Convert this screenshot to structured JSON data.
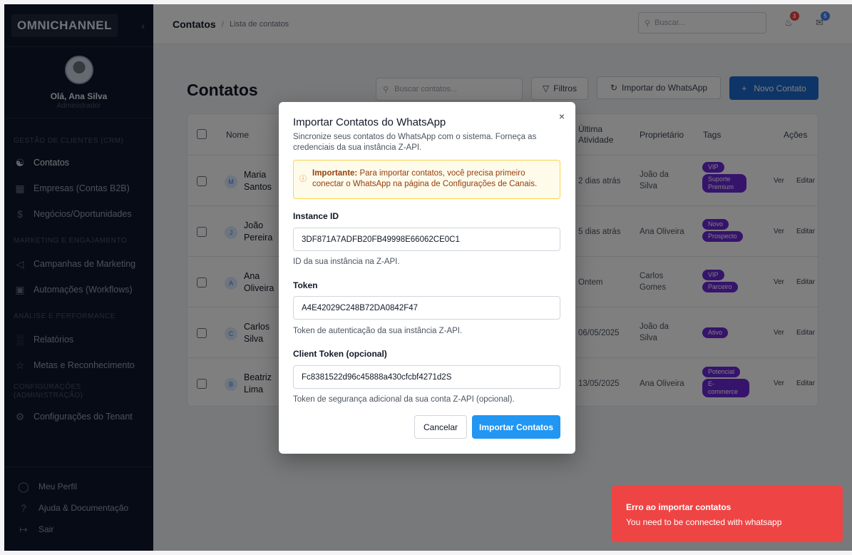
{
  "sidebar": {
    "logo": "OMNICHANNEL",
    "collapse": "‹",
    "greeting": "Olá, Ana Silva",
    "role": "Administrador",
    "sections": [
      {
        "title": "GESTÃO DE CLIENTES (CRM)"
      },
      {
        "title": "MARKETING E ENGAJAMENTO"
      },
      {
        "title": "ANÁLISE E PERFORMANCE"
      },
      {
        "title": "CONFIGURAÇÕES (ADMINISTRAÇÃO)"
      }
    ],
    "items": [
      {
        "label": "Contatos",
        "icon": "users-icon"
      },
      {
        "label": "Empresas (Contas B2B)",
        "icon": "building-icon"
      },
      {
        "label": "Negócios/Oportunidades",
        "icon": "dollar-icon"
      },
      {
        "label": "Campanhas de Marketing",
        "icon": "megaphone-icon"
      },
      {
        "label": "Automações (Workflows)",
        "icon": "bot-icon"
      },
      {
        "label": "Relatórios",
        "icon": "bar-chart-icon"
      },
      {
        "label": "Metas e Reconhecimento",
        "icon": "trophy-icon"
      },
      {
        "label": "Configurações do Tenant",
        "icon": "gear-icon"
      }
    ],
    "bottom": [
      {
        "label": "Meu Perfil",
        "icon": "user-icon"
      },
      {
        "label": "Ajuda & Documentação",
        "icon": "help-icon"
      },
      {
        "label": "Sair",
        "icon": "logout-icon"
      }
    ]
  },
  "topbar": {
    "breadcrumb_main": "Contatos",
    "breadcrumb_sep": "/",
    "breadcrumb_sub": "Lista de contatos",
    "search_placeholder": "Buscar...",
    "notifications_count": "3",
    "messages_count": "5"
  },
  "page": {
    "title": "Contatos",
    "search_placeholder": "Buscar contatos...",
    "filters_label": "Filtros",
    "import_label": "Importar do WhatsApp",
    "new_label": "Novo Contato",
    "new_icon": "+"
  },
  "table": {
    "headers": {
      "name": "Nome",
      "last_activity": "Última Atividade",
      "owner": "Proprietário",
      "tags": "Tags",
      "actions": "Ações"
    },
    "view_label": "Ver",
    "edit_label": "Editar",
    "rows": [
      {
        "initial": "M",
        "name": "Maria Santos",
        "activity": "2 dias atrás",
        "owner": "João da Silva",
        "tags": [
          "VIP",
          "Suporte Premium"
        ]
      },
      {
        "initial": "J",
        "name": "João Pereira",
        "activity": "5 dias atrás",
        "owner": "Ana Oliveira",
        "tags": [
          "Novo",
          "Prospecto"
        ]
      },
      {
        "initial": "A",
        "name": "Ana Oliveira",
        "activity": "Ontem",
        "owner": "Carlos Gomes",
        "tags": [
          "VIP",
          "Parceiro"
        ]
      },
      {
        "initial": "C",
        "name": "Carlos Silva",
        "activity": "06/05/2025",
        "owner": "João da Silva",
        "tags": [
          "Ativo"
        ]
      },
      {
        "initial": "B",
        "name": "Beatriz Lima",
        "activity": "13/05/2025",
        "owner": "Ana Oliveira",
        "tags": [
          "Potencial",
          "E-commerce"
        ]
      }
    ]
  },
  "modal": {
    "close": "×",
    "title": "Importar Contatos do WhatsApp",
    "description": "Sincronize seus contatos do WhatsApp com o sistema. Forneça as credenciais da sua instância Z-API.",
    "alert_strong": "Importante:",
    "alert_text": "Para importar contatos, você precisa primeiro conectar o WhatsApp na página de Configurações de Canais.",
    "instance_label": "Instance ID",
    "instance_value": "3DF871A7ADFB20FB49998E66062CE0C1",
    "instance_help": "ID da sua instância na Z-API.",
    "token_label": "Token",
    "token_value": "A4E42029C248B72DA0842F47",
    "token_help": "Token de autenticação da sua instância Z-API.",
    "client_label": "Client Token (opcional)",
    "client_value": "Fc8381522d96c45888a430cfcbf4271d2S",
    "client_help": "Token de segurança adicional da sua conta Z-API (opcional).",
    "cancel": "Cancelar",
    "submit": "Importar Contatos"
  },
  "toast": {
    "title": "Erro ao importar contatos",
    "message": "You need to be connected with whatsapp",
    "color": "#ef4444"
  }
}
